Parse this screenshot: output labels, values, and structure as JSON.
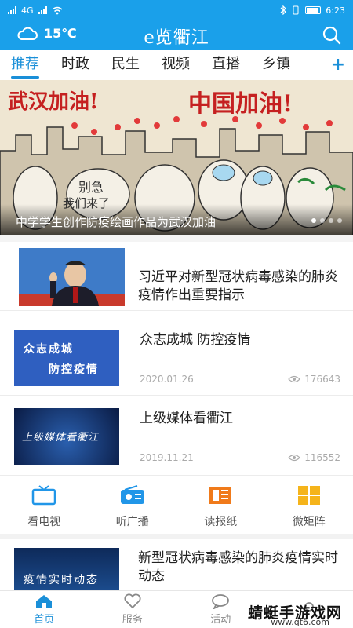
{
  "status_bar": {
    "network": "4G",
    "time": "6:23"
  },
  "header": {
    "temperature": "15℃",
    "title": "e览衢江",
    "weather_icon": "cloud-icon",
    "search_icon": "search-icon"
  },
  "tabs": [
    {
      "label": "推荐",
      "active": true
    },
    {
      "label": "时政",
      "active": false
    },
    {
      "label": "民生",
      "active": false
    },
    {
      "label": "视频",
      "active": false
    },
    {
      "label": "直播",
      "active": false
    },
    {
      "label": "乡镇",
      "active": false
    }
  ],
  "tab_add": "+",
  "banner": {
    "caption": "中学学生创作防疫绘画作品为武汉加油",
    "art_text_1": "武汉加油!",
    "art_text_2": "中国加油!",
    "art_text_3": "别急",
    "art_text_4": "我们来了",
    "dots": 4,
    "active_dot": 0
  },
  "news": [
    {
      "title": "习近平对新型冠状病毒感染的肺炎疫情作出重要指示",
      "date": "",
      "views": ""
    },
    {
      "title": "众志成城 防控疫情",
      "thumb_text_1": "众志成城",
      "thumb_text_2": "防控疫情",
      "date": "2020.01.26",
      "views": "176643"
    },
    {
      "title": "上级媒体看衢江",
      "thumb_text": "上级媒体看衢江",
      "date": "2019.11.21",
      "views": "116552"
    },
    {
      "title": "新型冠状病毒感染的肺炎疫情实时动态",
      "thumb_text": "疫情实时动态"
    }
  ],
  "quick_links": [
    {
      "label": "看电视",
      "icon": "tv-icon"
    },
    {
      "label": "听广播",
      "icon": "radio-icon"
    },
    {
      "label": "读报纸",
      "icon": "newspaper-icon"
    },
    {
      "label": "微矩阵",
      "icon": "grid-icon"
    }
  ],
  "bottom_nav": [
    {
      "label": "首页",
      "icon": "home-icon",
      "active": true
    },
    {
      "label": "服务",
      "icon": "heart-icon",
      "active": false
    },
    {
      "label": "活动",
      "icon": "chat-icon",
      "active": false
    },
    {
      "label": "",
      "icon": "user-icon",
      "active": false
    }
  ],
  "watermark": {
    "text": "蜻蜓手游戏网",
    "url": "www.qt6.com"
  },
  "colors": {
    "primary": "#1aa0ea",
    "accent": "#1a8fd8",
    "tv": "#2196e8",
    "news": "#f07a1a",
    "matrix": "#f5b41b"
  }
}
